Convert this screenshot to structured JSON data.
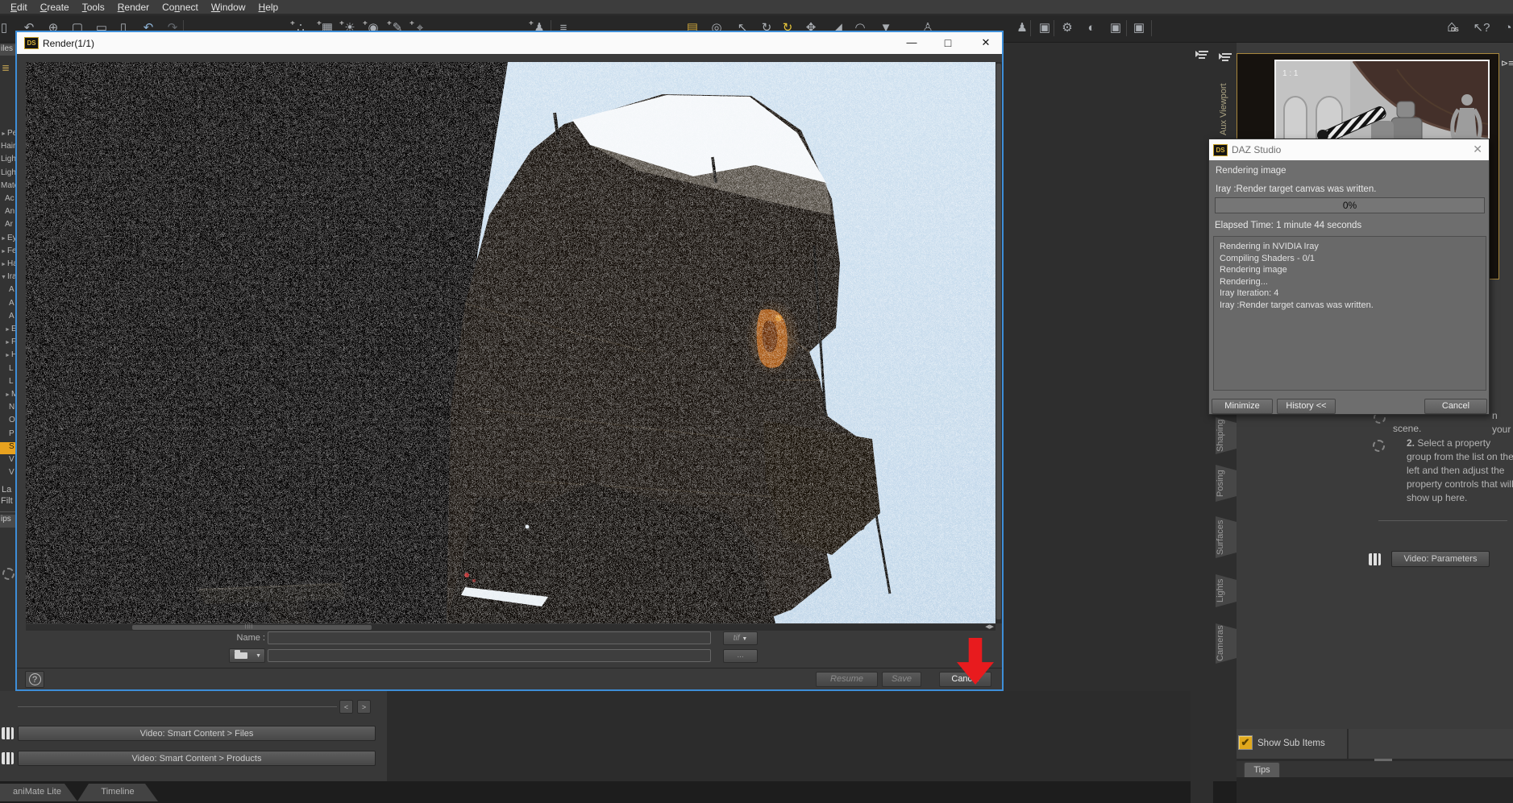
{
  "menu_bar": {
    "items": [
      {
        "label": "Edit",
        "underline": 0
      },
      {
        "label": "Create",
        "underline": 0
      },
      {
        "label": "Tools",
        "underline": 0
      },
      {
        "label": "Render",
        "underline": 0
      },
      {
        "label": "Connect",
        "underline": 2
      },
      {
        "label": "Window",
        "underline": 0
      },
      {
        "label": "Help",
        "underline": 0
      }
    ]
  },
  "toolbar": {
    "icons": [
      "new-file-icon",
      "import-icon",
      "globe-icon",
      "window-icon",
      "page-icon",
      "page-icon-2",
      "undo-icon",
      "redo-icon",
      "add-figure-icon",
      "add-prop-icon",
      "add-light-icon",
      "add-sphere-icon",
      "add-brush-icon",
      "add-node-icon",
      "add-person-icon",
      "list-icon",
      "film-brick-icon",
      "pan-icon",
      "node-cursor-icon",
      "rotate-tool-icon",
      "active-rotate-tool-icon",
      "translate-tool-icon",
      "scale-tool-icon",
      "dform-tool-icon",
      "weight-map-tool-icon",
      "figure-icon",
      "person-select-icon",
      "camera-select-icon",
      "cursor-settings-icon",
      "sphere-settings-icon",
      "camera-settings-icon",
      "camera-icon",
      "help-cursor-icon",
      "clock-icon"
    ],
    "home_label": "DS"
  },
  "render_window": {
    "title": "Render(1/1)",
    "icon": "ds-logo",
    "name_label": "Name :",
    "name_value": "",
    "format_value": "tif",
    "browse_label": "...",
    "resume_label": "Resume",
    "save_label": "Save",
    "cancel_label": "Cancel",
    "help_label": "?"
  },
  "progress_dialog": {
    "title": "DAZ Studio",
    "status": "Rendering image",
    "message": "Iray :Render target canvas was written.",
    "progress_value": "0%",
    "elapsed": "Elapsed Time:  1 minute 44 seconds",
    "log_lines": [
      "Rendering in NVIDIA Iray",
      "Compiling Shaders - 0/1",
      "Rendering image",
      "Rendering...",
      "Iray Iteration: 4",
      "Iray :Render target canvas was written."
    ],
    "minimize_label": "Minimize",
    "history_label": "History <<",
    "cancel_label": "Cancel"
  },
  "aux_viewport": {
    "tab_label": "Aux Viewport",
    "ratio_label": "1 : 1"
  },
  "right_dock": {
    "tabs": [
      "Shaping",
      "Posing",
      "Surfaces",
      "Lights",
      "Cameras"
    ],
    "instruction_1": {
      "line1": "n your",
      "line2": "scene."
    },
    "instruction_2": {
      "num": "2.",
      "lines": [
        "Select a property group",
        "from the list on the left and",
        "then adjust the property",
        "controls that will show up",
        "here."
      ]
    },
    "video_parameters_label": "Video: Parameters",
    "show_sub_items_label": "Show Sub Items",
    "checkbox_checked": "✔",
    "tips_tab_label": "Tips"
  },
  "left_sidebar": {
    "top_tab_label": "iles",
    "items": [
      {
        "marker": "►",
        "text": "Pe",
        "indent": 0,
        "selected": false
      },
      {
        "marker": "",
        "text": "Hair",
        "indent": 0,
        "selected": false
      },
      {
        "marker": "",
        "text": "Light",
        "indent": 0,
        "selected": false
      },
      {
        "marker": "",
        "text": "Light",
        "indent": 0,
        "selected": false
      },
      {
        "marker": "",
        "text": "Mate",
        "indent": 0,
        "selected": false
      },
      {
        "marker": "",
        "text": "Ac",
        "indent": 1,
        "selected": false
      },
      {
        "marker": "",
        "text": "An",
        "indent": 1,
        "selected": false
      },
      {
        "marker": "",
        "text": "Ar",
        "indent": 1,
        "selected": false
      },
      {
        "marker": "►",
        "text": "Ey",
        "indent": 0,
        "selected": false
      },
      {
        "marker": "►",
        "text": "Fe",
        "indent": 0,
        "selected": false
      },
      {
        "marker": "►",
        "text": "Ha",
        "indent": 0,
        "selected": false
      },
      {
        "marker": "▼",
        "text": "Ira",
        "indent": 0,
        "selected": false
      },
      {
        "marker": "",
        "text": "A",
        "indent": 2,
        "selected": false
      },
      {
        "marker": "",
        "text": "A",
        "indent": 2,
        "selected": false
      },
      {
        "marker": "",
        "text": "A",
        "indent": 2,
        "selected": false
      },
      {
        "marker": "►",
        "text": "E",
        "indent": 1,
        "selected": false
      },
      {
        "marker": "►",
        "text": "F",
        "indent": 1,
        "selected": false
      },
      {
        "marker": "►",
        "text": "H",
        "indent": 1,
        "selected": false
      },
      {
        "marker": "",
        "text": "L",
        "indent": 2,
        "selected": false
      },
      {
        "marker": "",
        "text": "L",
        "indent": 2,
        "selected": false
      },
      {
        "marker": "►",
        "text": "M",
        "indent": 1,
        "selected": false
      },
      {
        "marker": "",
        "text": "N",
        "indent": 2,
        "selected": false
      },
      {
        "marker": "",
        "text": "O",
        "indent": 2,
        "selected": false
      },
      {
        "marker": "",
        "text": "P",
        "indent": 2,
        "selected": false
      },
      {
        "marker": "",
        "text": "S",
        "indent": 2,
        "selected": true
      },
      {
        "marker": "",
        "text": "V",
        "indent": 2,
        "selected": false
      },
      {
        "marker": "",
        "text": "V",
        "indent": 2,
        "selected": false
      }
    ],
    "label_caption": "La",
    "filter_caption": "Filt",
    "tips_tab_label": "ips"
  },
  "bottom_panel": {
    "prev_label": "<",
    "next_label": ">",
    "video_files_label": "Video: Smart Content > Files",
    "video_products_label": "Video: Smart Content > Products"
  },
  "bottom_tabs": {
    "animate_label": "aniMate Lite",
    "timeline_label": "Timeline"
  },
  "colors": {
    "accent_blue": "#3e8ed8",
    "selection_yellow": "#e8a21f",
    "gold_border": "#a8873d",
    "arrow_red": "#e81b1e",
    "dialog_gray": "#6e6e6e",
    "sky_blue": "#c9dcec"
  }
}
